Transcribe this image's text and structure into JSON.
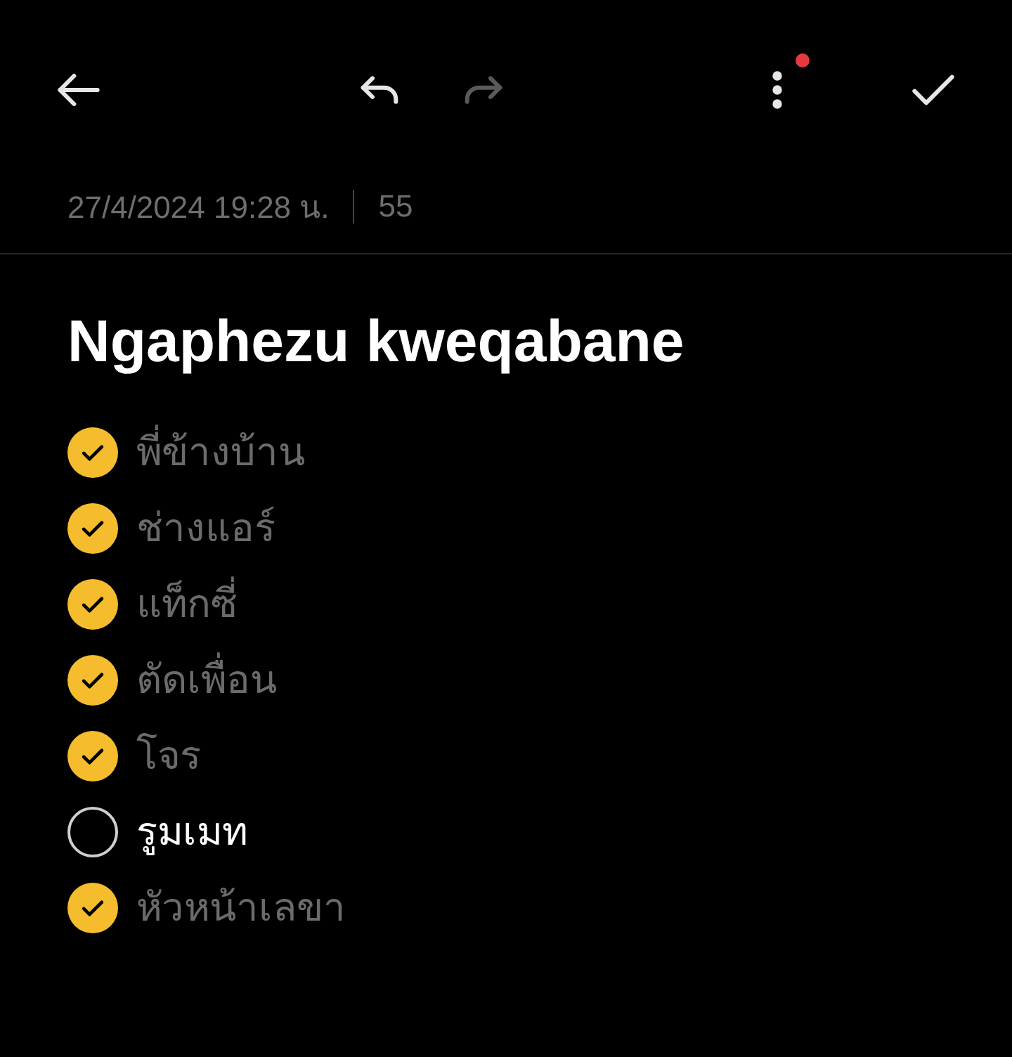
{
  "toolbar": {
    "undo_disabled": false,
    "redo_disabled": true,
    "menu_badge": true
  },
  "meta": {
    "date": "27/4/2024 19:28 น.",
    "count": "55"
  },
  "title": "Ngaphezu kweqabane",
  "items": [
    {
      "text": "พี่ข้างบ้าน",
      "checked": true
    },
    {
      "text": "ช่างแอร์",
      "checked": true
    },
    {
      "text": "แท็กซี่",
      "checked": true
    },
    {
      "text": "ตัดเพื่อน",
      "checked": true
    },
    {
      "text": "โจร",
      "checked": true
    },
    {
      "text": "รูมเมท",
      "checked": false
    },
    {
      "text": "หัวหน้าเลขา",
      "checked": true
    }
  ]
}
